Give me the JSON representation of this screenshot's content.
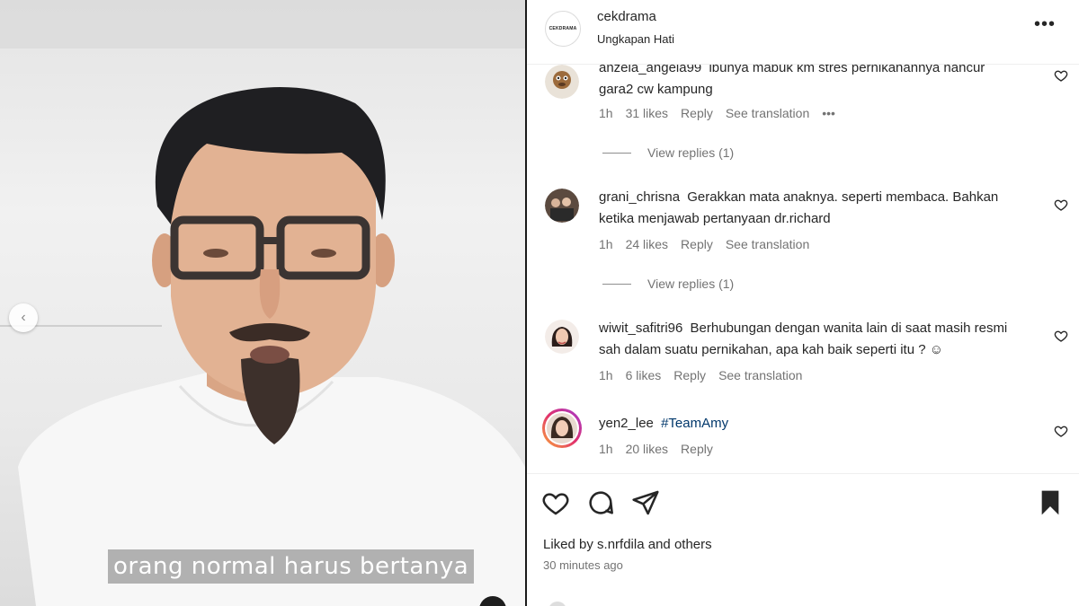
{
  "post": {
    "username": "cekdrama",
    "location": "Ungkapan Hati",
    "avatar_text": "CEKDRAMA",
    "more_label": "•••"
  },
  "media": {
    "subtitle": "orang normal harus bertanya",
    "prev_arrow": "‹"
  },
  "comments": [
    {
      "username": "anzela_angela99",
      "text": "ibunya mabuk km stres pernikahannya hancur gara2 cw kampung",
      "time": "1h",
      "likes": "31 likes",
      "reply": "Reply",
      "translate": "See translation",
      "more": "•••",
      "view_replies": "View replies (1)"
    },
    {
      "username": "grani_chrisna",
      "text": "Gerakkan mata anaknya. seperti membaca. Bahkan ketika menjawab pertanyaan dr.richard",
      "time": "1h",
      "likes": "24 likes",
      "reply": "Reply",
      "translate": "See translation",
      "view_replies": "View replies (1)"
    },
    {
      "username": "wiwit_safitri96",
      "text": "Berhubungan dengan wanita lain di saat masih resmi sah dalam suatu pernikahan, apa kah baik seperti itu ? ☺",
      "time": "1h",
      "likes": "6 likes",
      "reply": "Reply",
      "translate": "See translation"
    },
    {
      "username": "yen2_lee",
      "text": "#TeamAmy",
      "time": "1h",
      "likes": "20 likes",
      "reply": "Reply"
    }
  ],
  "footer": {
    "liked_prefix": "Liked by",
    "liked_user": "s.nrfdila",
    "liked_and": "and",
    "liked_others": "others",
    "time_ago": "30 minutes ago"
  },
  "icons": {
    "like": "heart-icon",
    "comment": "comment-icon",
    "share": "send-icon",
    "save": "bookmark-icon"
  },
  "colors": {
    "text": "#262626",
    "muted": "#737373",
    "hashtag": "#00376b"
  }
}
